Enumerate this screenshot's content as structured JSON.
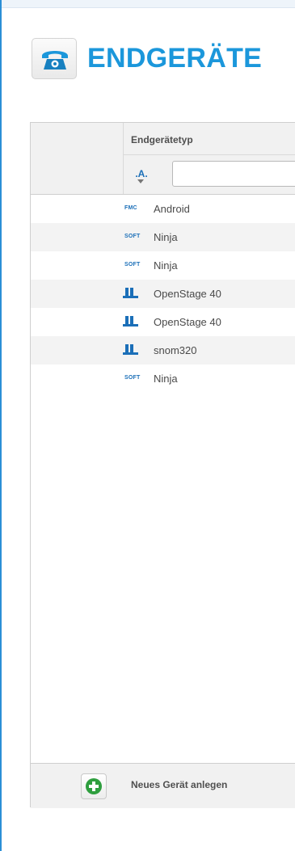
{
  "header": {
    "title": "ENDGERÄTE",
    "icon": "telephone-icon"
  },
  "table": {
    "column_header": "Endgerätetyp",
    "filter": {
      "sort_label": ".A.",
      "value": ""
    },
    "rows": [
      {
        "type_badge": "FMC",
        "icon": "fmc-badge-icon",
        "name": "Android"
      },
      {
        "type_badge": "SOFT",
        "icon": "soft-badge-icon",
        "name": "Ninja"
      },
      {
        "type_badge": "SOFT",
        "icon": "soft-badge-icon",
        "name": "Ninja"
      },
      {
        "type_badge": "",
        "icon": "desk-phone-icon",
        "name": "OpenStage 40"
      },
      {
        "type_badge": "",
        "icon": "desk-phone-icon",
        "name": "OpenStage 40"
      },
      {
        "type_badge": "",
        "icon": "desk-phone-icon",
        "name": "snom320"
      },
      {
        "type_badge": "SOFT",
        "icon": "soft-badge-icon",
        "name": "Ninja"
      }
    ]
  },
  "footer": {
    "add_label": "Neues Gerät anlegen",
    "add_icon": "add-circle-icon"
  },
  "colors": {
    "accent": "#1b97db",
    "add_green": "#2e9e3e"
  }
}
